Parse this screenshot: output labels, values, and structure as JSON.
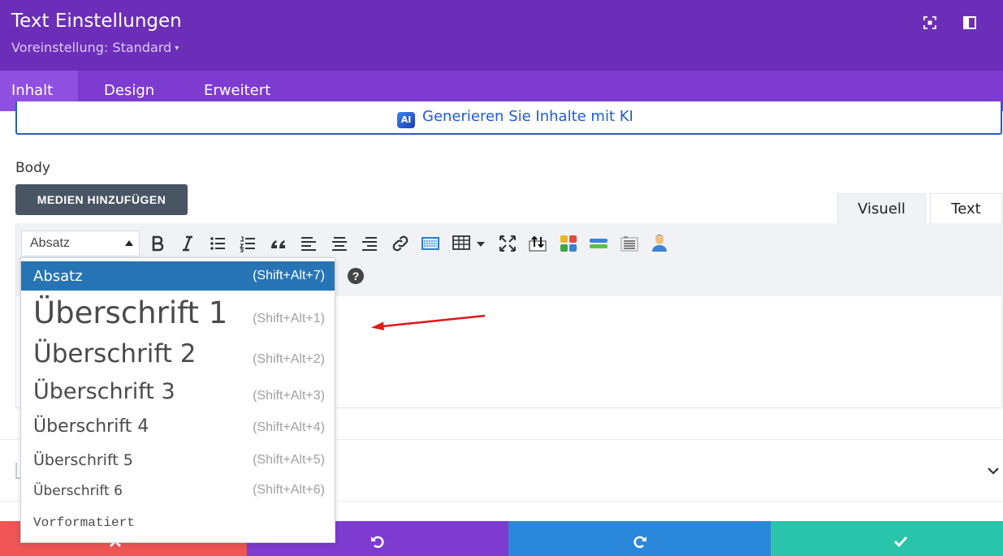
{
  "header": {
    "title": "Text Einstellungen",
    "preset_label": "Voreinstellung: Standard",
    "preset_caret": "▾"
  },
  "tabs": [
    {
      "label": "Inhalt",
      "active": true
    },
    {
      "label": "Design",
      "active": false
    },
    {
      "label": "Erweitert",
      "active": false
    }
  ],
  "ai": {
    "badge": "AI",
    "label": "Generieren Sie Inhalte mit KI"
  },
  "body": {
    "label": "Body",
    "add_media_label": "MEDIEN HINZUFÜGEN"
  },
  "view_tabs": {
    "visual": "Visuell",
    "text": "Text"
  },
  "toolbar": {
    "format_selected": "Absatz",
    "help_label": "?"
  },
  "format_dropdown": {
    "items": [
      {
        "label": "Absatz",
        "shortcut": "(Shift+Alt+7)",
        "active": true
      },
      {
        "label": "Überschrift 1",
        "shortcut": "(Shift+Alt+1)"
      },
      {
        "label": "Überschrift 2",
        "shortcut": "(Shift+Alt+2)"
      },
      {
        "label": "Überschrift 3",
        "shortcut": "(Shift+Alt+3)"
      },
      {
        "label": "Überschrift 4",
        "shortcut": "(Shift+Alt+4)"
      },
      {
        "label": "Überschrift 5",
        "shortcut": "(Shift+Alt+5)"
      },
      {
        "label": "Überschrift 6",
        "shortcut": "(Shift+Alt+6)"
      },
      {
        "label": "Vorformatiert",
        "shortcut": ""
      }
    ]
  },
  "colors": {
    "header_bg": "#6c2eb9",
    "tabs_bg": "#7e3bd0",
    "active_tab": "#8f4fe0",
    "discard": "#ef5555",
    "undo": "#7e3bd0",
    "redo": "#2b87da",
    "save": "#29c4a9",
    "selected_item": "#2774b5"
  }
}
